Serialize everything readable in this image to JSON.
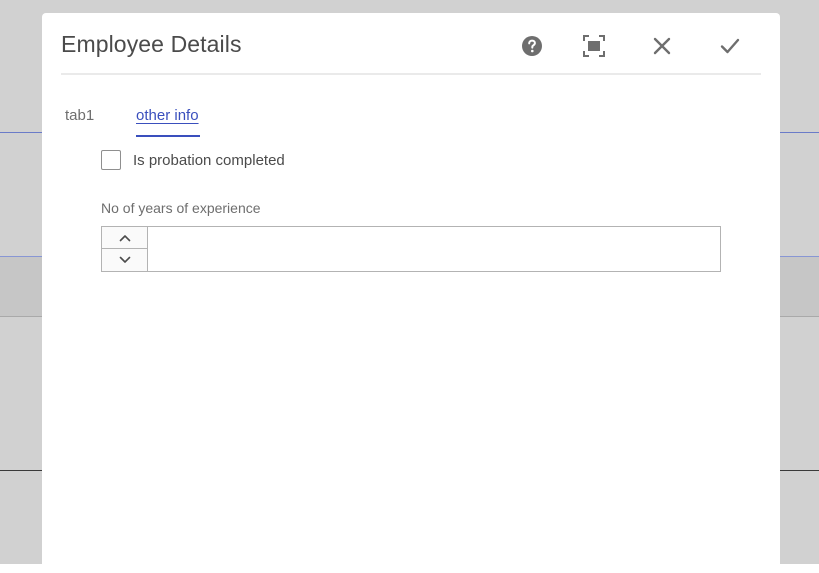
{
  "dialog": {
    "title": "Employee Details",
    "header_icons": [
      "help-icon",
      "fullscreen-icon",
      "close-icon",
      "checkmark-icon"
    ]
  },
  "tabs": [
    {
      "label": "tab1",
      "active": false
    },
    {
      "label": "other info",
      "active": true
    }
  ],
  "form": {
    "probation_checkbox": {
      "label": "Is probation completed",
      "checked": false
    },
    "experience_field": {
      "label": "No of years of experience",
      "value": "",
      "placeholder": ""
    }
  },
  "colors": {
    "accent": "#3a4fbd",
    "backdrop": "#d1d1d1",
    "icon": "#6e6e6e"
  }
}
